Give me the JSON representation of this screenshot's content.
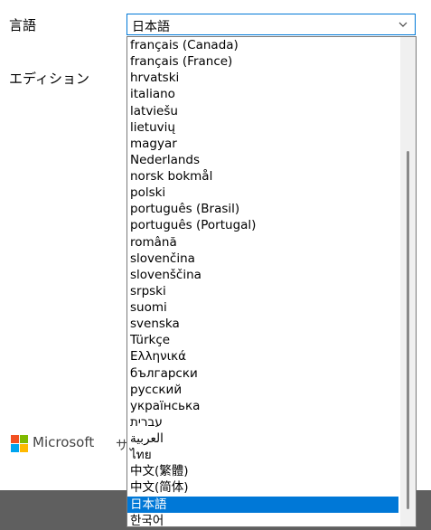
{
  "labels": {
    "language": "言語",
    "edition": "エディション"
  },
  "language_select": {
    "selected": "日本語",
    "chevron_icon": "chevron-down-icon"
  },
  "dropdown": {
    "items": [
      "français (Canada)",
      "français (France)",
      "hrvatski",
      "italiano",
      "latviešu",
      "lietuvių",
      "magyar",
      "Nederlands",
      "norsk bokmål",
      "polski",
      "português (Brasil)",
      "português (Portugal)",
      "română",
      "slovenčina",
      "slovenščina",
      "srpski",
      "suomi",
      "svenska",
      "Türkçe",
      "Ελληνικά",
      "български",
      "русский",
      "українська",
      "עברית",
      "العربية",
      "ไทย",
      "中文(繁體)",
      "中文(简体)",
      "日本語",
      "한국어"
    ],
    "selected_index": 28
  },
  "footer": {
    "brand": "Microsoft",
    "partial_text": "サ",
    "logo_colors": [
      "#f25022",
      "#7fba00",
      "#00a4ef",
      "#ffb900"
    ]
  },
  "colors": {
    "accent": "#0078d7",
    "bottom_bar": "#5f5f5f"
  }
}
